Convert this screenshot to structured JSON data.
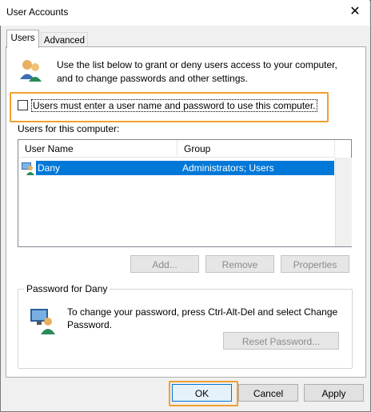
{
  "window": {
    "title": "User Accounts",
    "close_glyph": "✕"
  },
  "tabs": [
    {
      "label": "Users",
      "active": true
    },
    {
      "label": "Advanced",
      "active": false
    }
  ],
  "intro": {
    "line1": "Use the list below to grant or deny users access to your computer,",
    "line2": "and to change passwords and other settings."
  },
  "checkbox": {
    "label": "Users must enter a user name and password to use this computer.",
    "checked": false
  },
  "users_list": {
    "label": "Users for this computer:",
    "columns": [
      "User Name",
      "Group"
    ],
    "rows": [
      {
        "user": "Dany",
        "group": "Administrators; Users",
        "selected": true
      }
    ]
  },
  "list_buttons": {
    "add": "Add...",
    "remove": "Remove",
    "properties": "Properties"
  },
  "password_group": {
    "title": "Password for Dany",
    "text_line1": "To change your password, press Ctrl-Alt-Del and select Change",
    "text_line2": "Password.",
    "reset_button": "Reset Password..."
  },
  "dialog_buttons": {
    "ok": "OK",
    "cancel": "Cancel",
    "apply": "Apply"
  },
  "colors": {
    "selection": "#0078d7",
    "highlight_outline": "#f0a030"
  },
  "icons": [
    "users-icon",
    "user-row-icon",
    "user-key-icon",
    "close-icon"
  ]
}
